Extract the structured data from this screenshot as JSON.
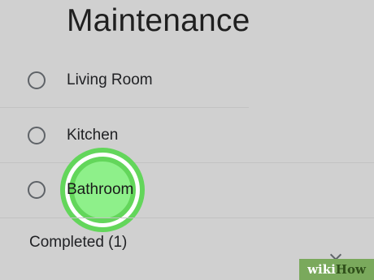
{
  "list": {
    "title": "Maintenance",
    "tasks": [
      {
        "label": "Living Room",
        "checked": false
      },
      {
        "label": "Kitchen",
        "checked": false
      },
      {
        "label": "Bathroom",
        "checked": false
      }
    ],
    "completed_label": "Completed (1)"
  },
  "tap_indicator": {
    "color": "#63d65b",
    "target": "Bathroom"
  },
  "watermark": {
    "wiki": "wiki",
    "how": "How"
  },
  "colors": {
    "background": "#d0d0d0",
    "tap_green": "#63d65b",
    "watermark_green": "#7aa95c"
  }
}
